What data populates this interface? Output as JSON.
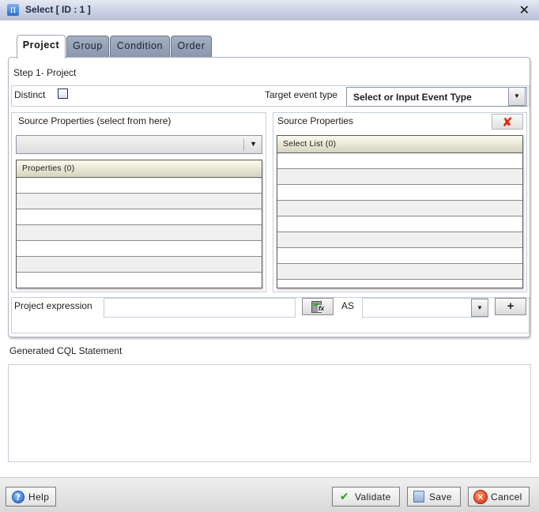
{
  "window": {
    "title": "Select [ ID : 1 ]",
    "icon": "pi-icon",
    "icon_glyph": "π",
    "close_glyph": "✕"
  },
  "tabs": [
    {
      "label": "Project",
      "active": true
    },
    {
      "label": "Group",
      "active": false
    },
    {
      "label": "Condition",
      "active": false
    },
    {
      "label": "Order",
      "active": false
    }
  ],
  "project": {
    "step_title": "Step 1- Project",
    "distinct_label": "Distinct",
    "distinct_checked": false,
    "target_event_type_label": "Target event type",
    "target_event_type_value": "Select or Input Event Type",
    "source_properties_label": "Source Properties (select from here)",
    "source_combo_value": "",
    "properties_table": {
      "header": "Properties (0)",
      "rows": []
    },
    "select_list_panel_label": "Source Properties",
    "remove_glyph": "✘",
    "select_list_table": {
      "header": "Select List (0)",
      "rows": []
    },
    "project_expression_label": "Project expression",
    "project_expression_value": "",
    "as_label": "AS",
    "as_value": "",
    "add_glyph": "+",
    "dropdown_glyph": "▼"
  },
  "cql": {
    "label": "Generated CQL Statement",
    "value": ""
  },
  "footer": {
    "help_label": "Help",
    "validate_label": "Validate",
    "save_label": "Save",
    "cancel_label": "Cancel",
    "help_glyph": "?",
    "validate_glyph": "✔",
    "cancel_glyph": "✕"
  },
  "colors": {
    "tab_inactive": "#97a3b8",
    "table_header": "#e8e6cf",
    "remove_red": "#e8200c",
    "validate_green": "#2e9a1e"
  }
}
